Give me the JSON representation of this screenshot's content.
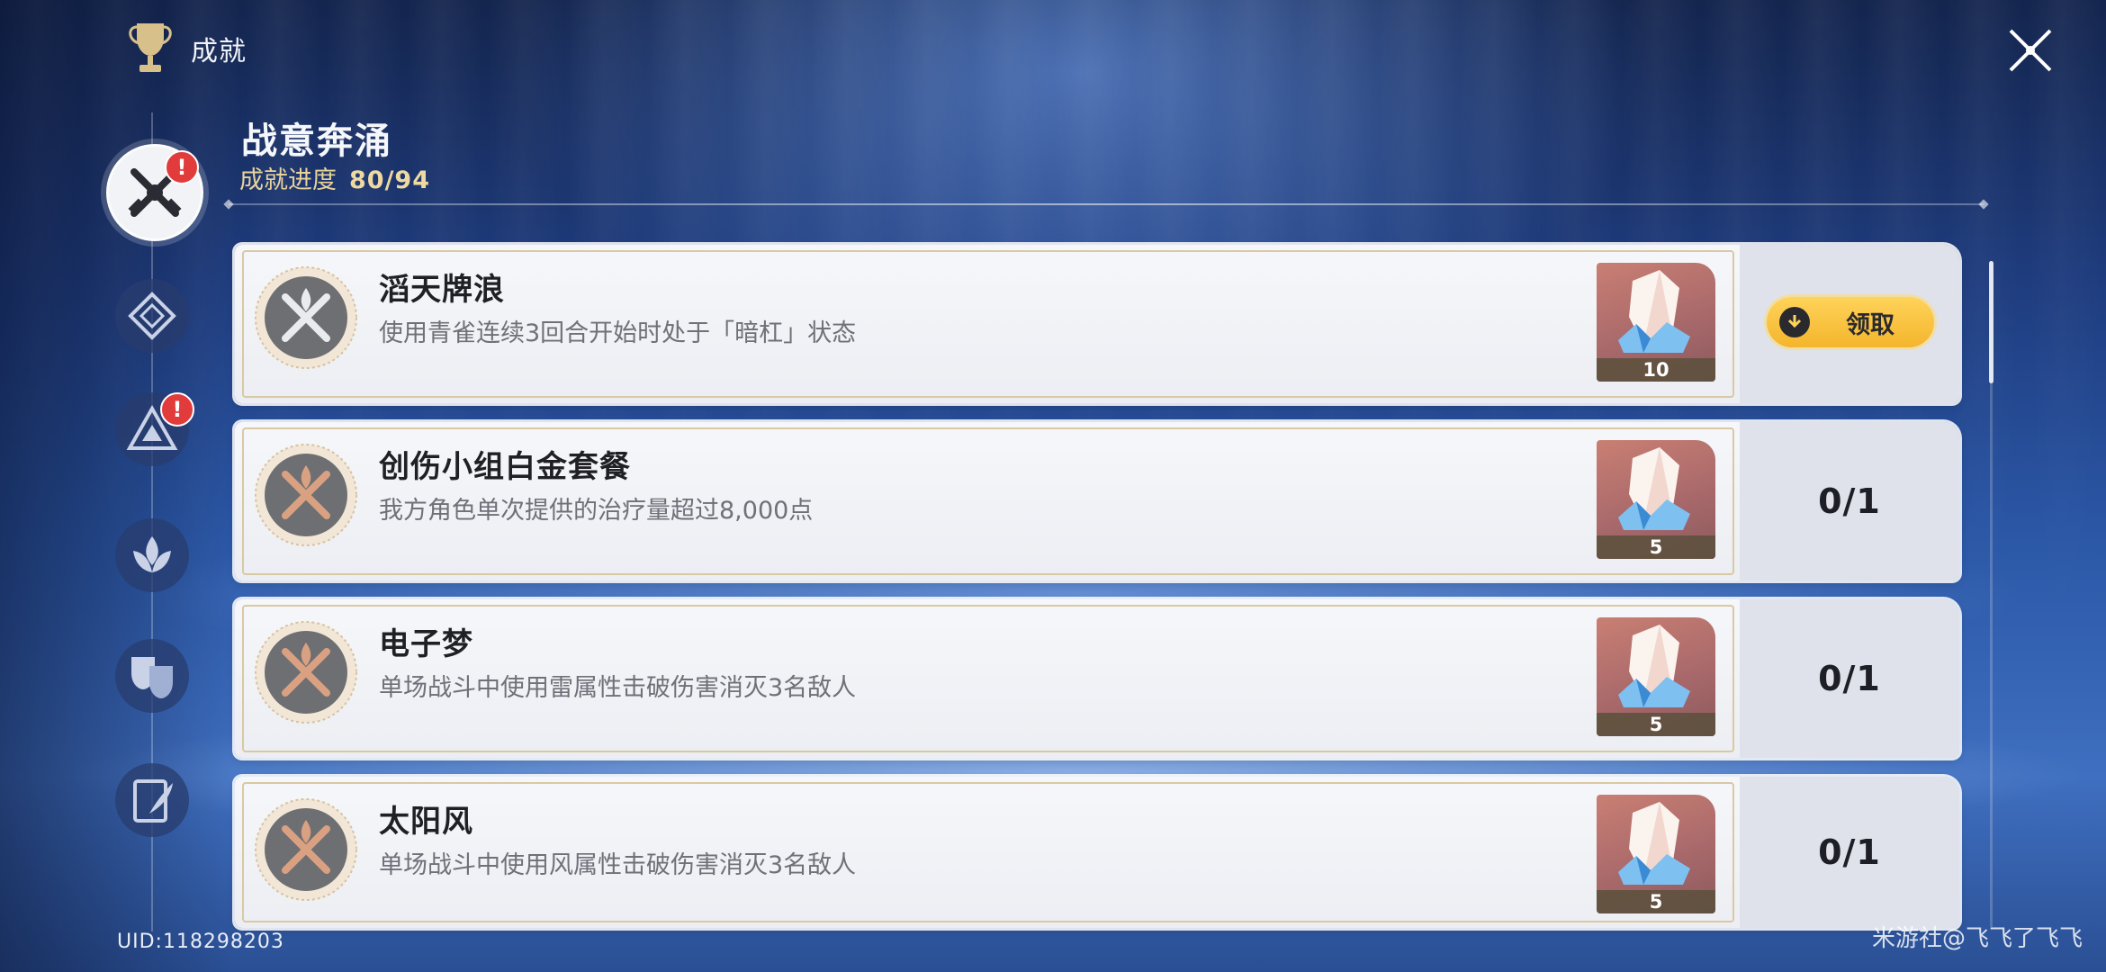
{
  "header": {
    "title": "成就",
    "trophy_icon": "trophy-icon",
    "close_icon": "close-icon"
  },
  "nav": {
    "items": [
      {
        "id": "battle",
        "icon": "crossed-swords-icon",
        "active": true,
        "alert": "!"
      },
      {
        "id": "explore",
        "icon": "diamond-emblem-icon",
        "active": false
      },
      {
        "id": "universe",
        "icon": "triangle-emblem-icon",
        "active": false,
        "alert": "!"
      },
      {
        "id": "vision",
        "icon": "lotus-emblem-icon",
        "active": false
      },
      {
        "id": "drama",
        "icon": "theater-masks-icon",
        "active": false
      },
      {
        "id": "story",
        "icon": "notebook-quill-icon",
        "active": false
      }
    ]
  },
  "category": {
    "title": "战意奔涌",
    "progress_label": "成就进度",
    "progress_value": "80/94"
  },
  "achievements": [
    {
      "name": "滔天牌浪",
      "desc": "使用青雀连续3回合开始时处于「暗杠」状态",
      "reward_count": "10",
      "status": "claim",
      "claim_label": "领取"
    },
    {
      "name": "创伤小组白金套餐",
      "desc": "我方角色单次提供的治疗量超过8,000点",
      "reward_count": "5",
      "status": "0/1"
    },
    {
      "name": "电子梦",
      "desc": "单场战斗中使用雷属性击破伤害消灭3名敌人",
      "reward_count": "5",
      "status": "0/1"
    },
    {
      "name": "太阳风",
      "desc": "单场战斗中使用风属性击破伤害消灭3名敌人",
      "reward_count": "5",
      "status": "0/1"
    }
  ],
  "footer": {
    "uid": "UID:118298203",
    "watermark": "米游社@飞飞了飞飞"
  },
  "colors": {
    "gold": "#f4b52c",
    "badge": "#e23b3b",
    "progress": "#e9d39a"
  }
}
